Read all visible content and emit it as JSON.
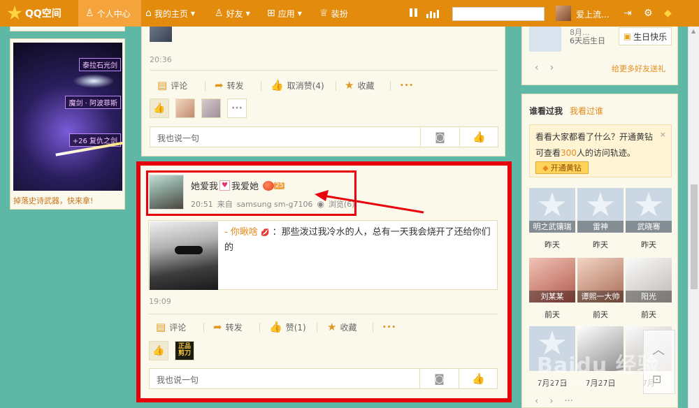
{
  "topbar": {
    "logo": "QQ空间",
    "nav": [
      {
        "label": "个人中心",
        "icon": "person-icon"
      },
      {
        "label": "我的主页",
        "icon": "home-icon"
      },
      {
        "label": "好友",
        "icon": "friends-icon"
      },
      {
        "label": "应用",
        "icon": "apps-icon"
      },
      {
        "label": "装扮",
        "icon": "tshirt-icon"
      }
    ],
    "user_name": "爱上流..."
  },
  "left": {
    "game_labels": [
      "泰拉石光剑",
      "魔剑 · 阿波菲斯",
      "+26 复仇之剑"
    ],
    "promo": "掉落史诗武器，快来拿!"
  },
  "feed_top": {
    "time": "20:36",
    "actions": [
      "评论",
      "转发",
      "取消赞(4)",
      "收藏"
    ],
    "comment_placeholder": "我也说一句"
  },
  "post": {
    "author_a": "她爱我",
    "author_b": "我爱她",
    "author_level": "25",
    "time": "20:51",
    "source_prefix": "来自",
    "source_device": "samsung sm-g7106",
    "views": "浏览(6)",
    "shared_nick": "- 你瞅啥",
    "shared_text": "：那些泼过我冷水的人，总有一天我会烧开了还给你们的",
    "post_time": "19:09",
    "actions": [
      "评论",
      "转发",
      "赞(1)",
      "收藏"
    ],
    "liker_badge": "正品 剪刀",
    "comment_placeholder": "我也说一句"
  },
  "right": {
    "birthday_line": "8月...",
    "birthday_days": "6天后生日",
    "birthday_button": "生日快乐",
    "send_more": "给更多好友送礼",
    "tab_who_saw_me": "谁看过我",
    "tab_i_saw": "我看过谁",
    "vip_line1": "看看大家都看了什么？开通黄钻",
    "vip_line2_a": "可查看",
    "vip_line2_n": "300",
    "vip_line2_b": "人的访问轨迹。",
    "vip_button": "开通黄钻",
    "visitors": [
      {
        "name": "明之武镶瑞",
        "when": "昨天"
      },
      {
        "name": "雷神",
        "when": "昨天"
      },
      {
        "name": "武晓骞",
        "when": "昨天"
      },
      {
        "name": "刘某某",
        "when": "前天"
      },
      {
        "name": "谭熙一大帅",
        "when": "前天"
      },
      {
        "name": "阳光",
        "when": "前天"
      },
      {
        "name": "",
        "when": "7月27日"
      },
      {
        "name": "",
        "when": "7月27日"
      },
      {
        "name": "",
        "when": "7月"
      }
    ]
  },
  "watermark": {
    "brand": "Baidu 经验",
    "url": "jingyan.baidu.com"
  }
}
